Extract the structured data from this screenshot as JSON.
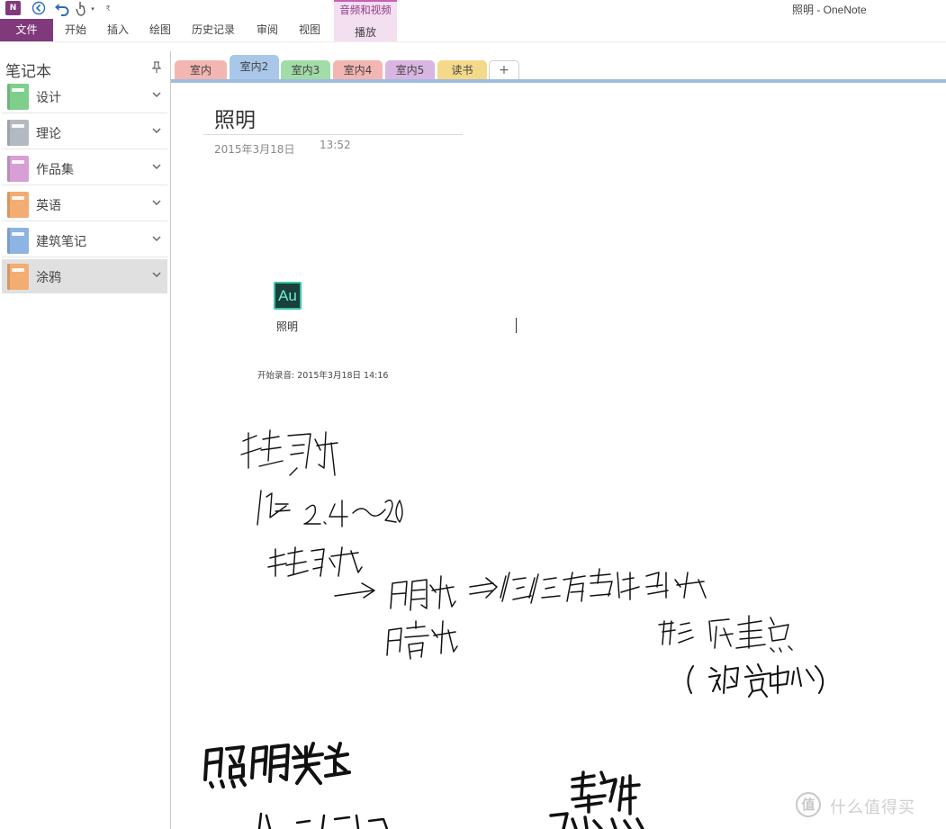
{
  "window": {
    "title": "照明 - OneNote",
    "app_logo_text": "N",
    "quick_access": [
      "back-icon",
      "undo-icon",
      "touch-mode-icon",
      "customize-dropdown-icon"
    ]
  },
  "ribbon": {
    "file_label": "文件",
    "tabs": [
      "开始",
      "插入",
      "绘图",
      "历史记录",
      "审阅",
      "视图"
    ],
    "contextual_group": "音频和视频",
    "contextual_tab": "播放",
    "accent_color": "#80397b"
  },
  "notebooks": {
    "header": "笔记本",
    "items": [
      {
        "label": "设计",
        "color": "#7fcf8c"
      },
      {
        "label": "理论",
        "color": "#b4b9c1"
      },
      {
        "label": "作品集",
        "color": "#d79fd4"
      },
      {
        "label": "英语",
        "color": "#f3ad72"
      },
      {
        "label": "建筑笔记",
        "color": "#8db4e2"
      },
      {
        "label": "涂鸦",
        "color": "#f3ad72",
        "selected": true
      }
    ]
  },
  "sections": {
    "tabs": [
      {
        "label": "室内",
        "color": "#f4b6b3"
      },
      {
        "label": "室内2",
        "color": "#a9c7e8",
        "active": true
      },
      {
        "label": "室内3",
        "color": "#a2dca6"
      },
      {
        "label": "室内4",
        "color": "#f4b6b3"
      },
      {
        "label": "室内5",
        "color": "#d9b6e2"
      },
      {
        "label": "读书",
        "color": "#f5d98a"
      }
    ],
    "add_label": "+"
  },
  "page": {
    "title": "照明",
    "date": "2015年3月18日",
    "time": "13:52",
    "audio": {
      "icon_text": "Au",
      "name": "照明",
      "record_start": "开始录音: 2015年3月18日 14:16"
    }
  },
  "watermark": {
    "icon_text": "值",
    "text": "什么值得买"
  }
}
